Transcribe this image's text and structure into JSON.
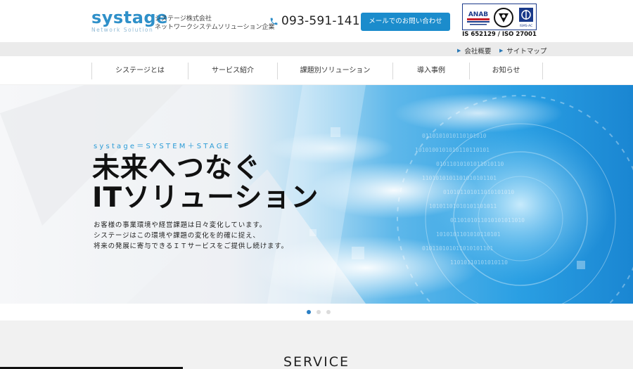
{
  "header": {
    "logo": {
      "wordmark": "systage",
      "subtitle": "Network Solution"
    },
    "tagline": [
      "システージ株式会社",
      "ネットワークシステムソリューション企業"
    ],
    "phone": "093-591-1415",
    "contact_button": "メールでのお問い合わせ",
    "certification": {
      "marks": [
        "ANAB",
        "ISMS-AC"
      ],
      "text": "IS 652129 / ISO 27001"
    }
  },
  "utility_links": [
    "会社概要",
    "サイトマップ"
  ],
  "nav": [
    "システージとは",
    "サービス紹介",
    "課題別ソリューション",
    "導入事例",
    "お知らせ"
  ],
  "hero": {
    "eyebrow": "systage＝SYSTEM＋STAGE",
    "title": [
      "未来へつなぐ",
      "ITソリューション"
    ],
    "description": [
      "お客様の事業環境や経営課題は日々変化しています。",
      "システージはこの環境や課題の変化を的確に捉え、",
      "将来の発展に寄与できるＩＴサービスをご提供し続けます。"
    ]
  },
  "slider": {
    "count": 3,
    "active": 1
  },
  "sections": {
    "service_heading": "SERVICE"
  },
  "colors": {
    "brand_blue": "#2f90c9",
    "button_blue": "#1b8ccc",
    "accent_cyan": "#2a9bd6",
    "util_bar": "#ebebeb",
    "section_bg": "#f1f1f1"
  },
  "icons": [
    "phone-icon",
    "arrow-right-icon"
  ]
}
